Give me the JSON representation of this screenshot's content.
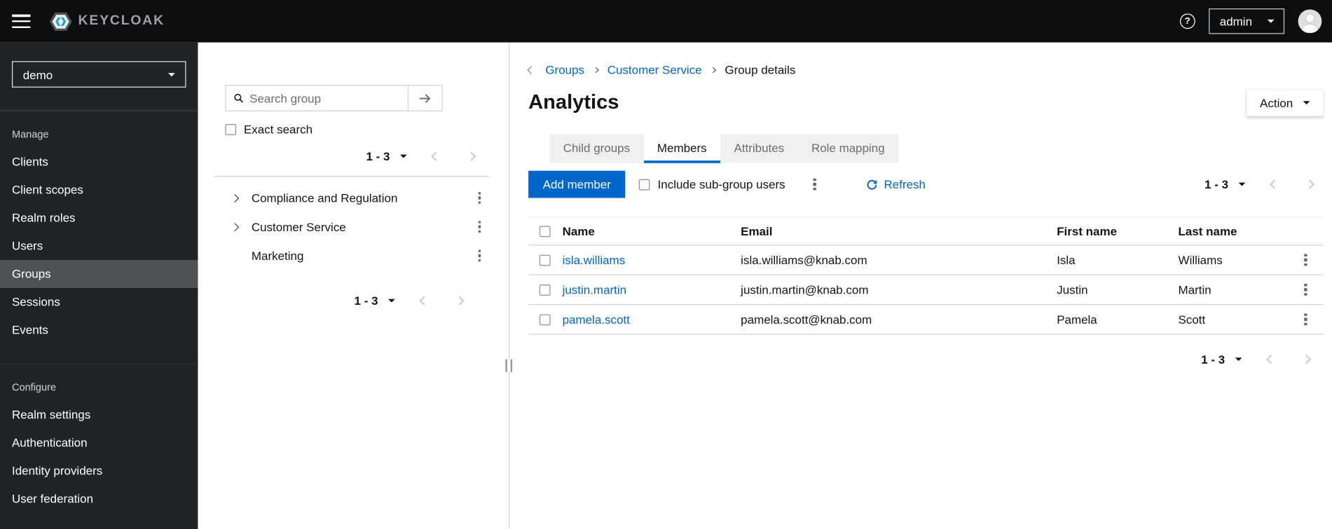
{
  "topbar": {
    "brand": "KEYCLOAK",
    "help_icon_glyph": "?",
    "user": "admin"
  },
  "sidebar": {
    "realm": "demo",
    "sections": [
      {
        "label": "Manage",
        "items": [
          {
            "label": "Clients",
            "active": false
          },
          {
            "label": "Client scopes",
            "active": false
          },
          {
            "label": "Realm roles",
            "active": false
          },
          {
            "label": "Users",
            "active": false
          },
          {
            "label": "Groups",
            "active": true
          },
          {
            "label": "Sessions",
            "active": false
          },
          {
            "label": "Events",
            "active": false
          }
        ]
      },
      {
        "label": "Configure",
        "items": [
          {
            "label": "Realm settings",
            "active": false
          },
          {
            "label": "Authentication",
            "active": false
          },
          {
            "label": "Identity providers",
            "active": false
          },
          {
            "label": "User federation",
            "active": false
          }
        ]
      }
    ]
  },
  "group_tree": {
    "search_placeholder": "Search group",
    "exact_search_label": "Exact search",
    "exact_search_checked": false,
    "top_pagination": "1 - 3",
    "items": [
      {
        "label": "Compliance and Regulation",
        "expandable": true
      },
      {
        "label": "Customer Service",
        "expandable": true
      },
      {
        "label": "Marketing",
        "expandable": false
      }
    ],
    "bottom_pagination": "1 - 3"
  },
  "main": {
    "breadcrumb": {
      "items": [
        "Groups",
        "Customer Service",
        "Group details"
      ]
    },
    "title": "Analytics",
    "action_button": "Action",
    "tabs": [
      {
        "label": "Child groups",
        "active": false
      },
      {
        "label": "Members",
        "active": true
      },
      {
        "label": "Attributes",
        "active": false
      },
      {
        "label": "Role mapping",
        "active": false
      }
    ],
    "members": {
      "add_member_button": "Add member",
      "include_subgroups_label": "Include sub-group users",
      "include_subgroups_checked": false,
      "refresh_label": "Refresh",
      "top_pagination": "1 - 3",
      "table": {
        "headers": [
          "Name",
          "Email",
          "First name",
          "Last name"
        ],
        "rows": [
          {
            "name": "isla.williams",
            "email": "isla.williams@knab.com",
            "first_name": "Isla",
            "last_name": "Williams"
          },
          {
            "name": "justin.martin",
            "email": "justin.martin@knab.com",
            "first_name": "Justin",
            "last_name": "Martin"
          },
          {
            "name": "pamela.scott",
            "email": "pamela.scott@knab.com",
            "first_name": "Pamela",
            "last_name": "Scott"
          }
        ]
      },
      "bottom_pagination": "1 - 3"
    }
  },
  "colors": {
    "accent": "#0066cc",
    "link": "#0066cc",
    "topbar_bg": "#0c0e0f",
    "sidebar_bg": "#212427",
    "sidebar_active_bg": "#4f5255",
    "tab_inactive_bg": "#f0f0f0",
    "border": "#d2d2d2"
  }
}
